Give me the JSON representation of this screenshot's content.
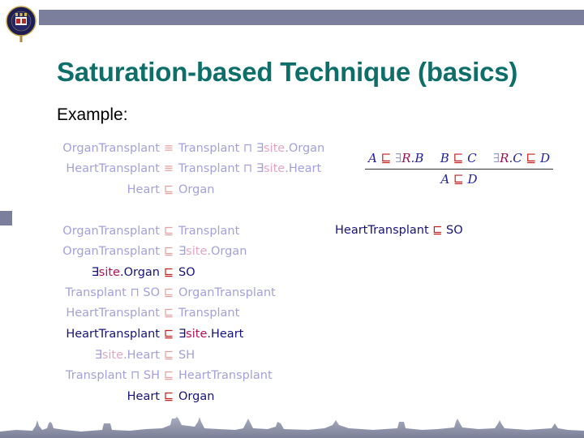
{
  "slide": {
    "title": "Saturation-based Technique (basics)",
    "subtitle": "Example:",
    "colors": {
      "title": "#0e6f6a",
      "accent_bar": "#7c7f9c",
      "concept_faded": "#a4a0dc",
      "concept_strong": "#16127e",
      "role": "#b0125a",
      "subsumption": "#c41e1e"
    }
  },
  "tbox_axioms": [
    {
      "lhs": "OrganTransplant",
      "op": "≡",
      "rhs_pre": "Transplant ⊓ ∃",
      "rhs_role": "site",
      "rhs_post": ".Organ",
      "style": "faded"
    },
    {
      "lhs": "HeartTransplant",
      "op": "≡",
      "rhs_pre": "Transplant ⊓ ∃",
      "rhs_role": "site",
      "rhs_post": ".Heart",
      "style": "faded"
    },
    {
      "lhs": "Heart",
      "op": "⊑",
      "rhs_pre": "Organ",
      "rhs_role": "",
      "rhs_post": "",
      "style": "faded"
    }
  ],
  "normalized_axioms": [
    {
      "lhs_pre": "OrganTransplant",
      "lhs_role": "",
      "lhs_post": "",
      "op": "⊑",
      "rhs_pre": "Transplant",
      "rhs_role": "",
      "rhs_post": "",
      "style": "faded"
    },
    {
      "lhs_pre": "OrganTransplant",
      "lhs_role": "",
      "lhs_post": "",
      "op": "⊑",
      "rhs_pre": "∃",
      "rhs_role": "site",
      "rhs_post": ".Organ",
      "style": "faded"
    },
    {
      "lhs_pre": "∃",
      "lhs_role": "site",
      "lhs_post": ".Organ",
      "op": "⊑",
      "rhs_pre": "SO",
      "rhs_role": "",
      "rhs_post": "",
      "style": "strong"
    },
    {
      "lhs_pre": "Transplant ⊓ SO",
      "lhs_role": "",
      "lhs_post": "",
      "op": "⊑",
      "rhs_pre": "OrganTransplant",
      "rhs_role": "",
      "rhs_post": "",
      "style": "faded"
    },
    {
      "lhs_pre": "HeartTransplant",
      "lhs_role": "",
      "lhs_post": "",
      "op": "⊑",
      "rhs_pre": "Transplant",
      "rhs_role": "",
      "rhs_post": "",
      "style": "faded"
    },
    {
      "lhs_pre": "HeartTransplant",
      "lhs_role": "",
      "lhs_post": "",
      "op": "⊑",
      "rhs_pre": "∃",
      "rhs_role": "site",
      "rhs_post": ".Heart",
      "style": "strong"
    },
    {
      "lhs_pre": "∃",
      "lhs_role": "site",
      "lhs_post": ".Heart",
      "op": "⊑",
      "rhs_pre": "SH",
      "rhs_role": "",
      "rhs_post": "",
      "style": "faded"
    },
    {
      "lhs_pre": "Transplant ⊓ SH",
      "lhs_role": "",
      "lhs_post": "",
      "op": "⊑",
      "rhs_pre": "HeartTransplant",
      "rhs_role": "",
      "rhs_post": "",
      "style": "faded"
    },
    {
      "lhs_pre": "Heart",
      "lhs_role": "",
      "lhs_post": "",
      "op": "⊑",
      "rhs_pre": "Organ",
      "rhs_role": "",
      "rhs_post": "",
      "style": "strong"
    }
  ],
  "inference_rule": {
    "premise1": {
      "a": "A",
      "op": "⊑",
      "ex": "∃",
      "role": "R",
      "b": ".B"
    },
    "premise2": {
      "a": "B",
      "op": "⊑",
      "b": "C"
    },
    "premise3": {
      "ex": "∃",
      "role": "R",
      "a": ".C",
      "op": "⊑",
      "b": "D"
    },
    "conclusion": {
      "a": "A",
      "op": "⊑",
      "b": "D"
    }
  },
  "derived": {
    "lhs": "HeartTransplant",
    "op": "⊑",
    "rhs": "SO"
  }
}
